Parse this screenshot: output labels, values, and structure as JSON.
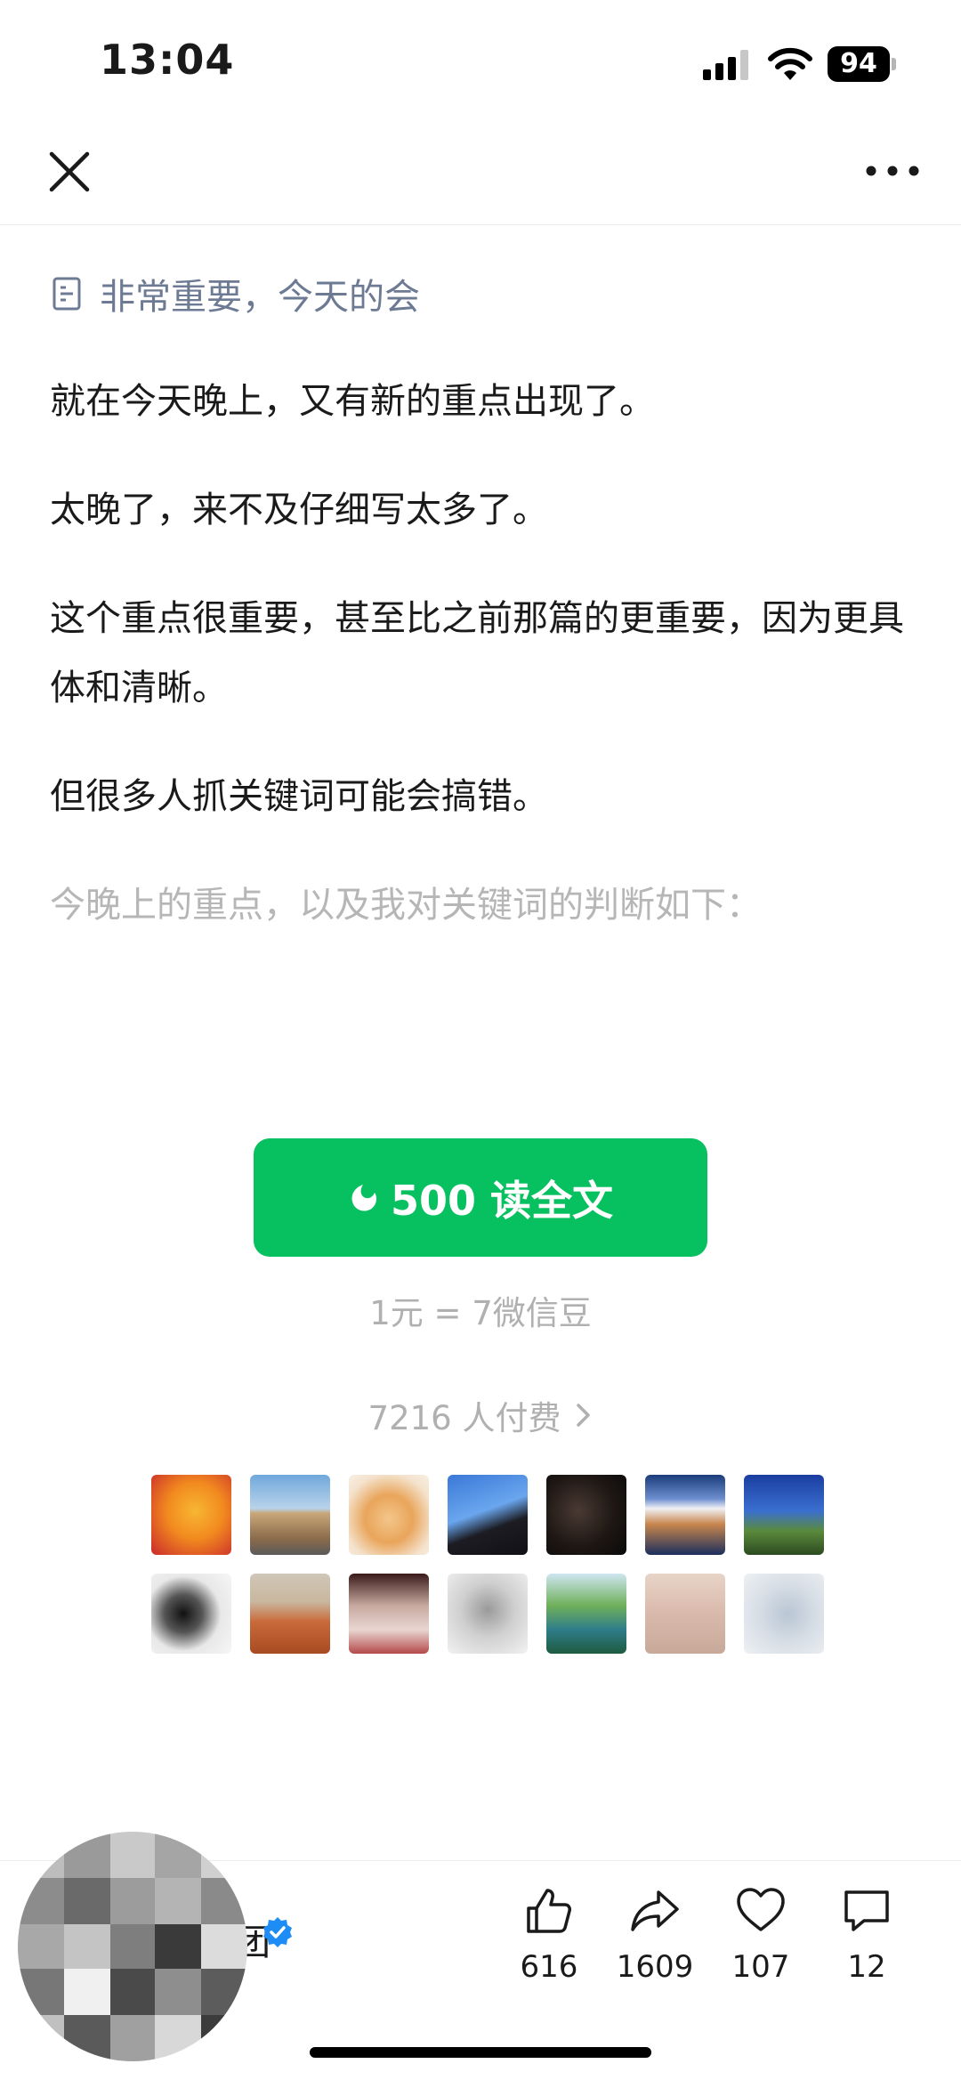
{
  "status_bar": {
    "time": "13:04",
    "battery": "94"
  },
  "nav": {
    "close_icon": "close-icon",
    "more_icon": "more-icon"
  },
  "article": {
    "title": "非常重要，今天的会",
    "paragraphs": [
      "就在今天晚上，又有新的重点出现了。",
      "太晚了，来不及仔细写太多了。",
      "这个重点很重要，甚至比之前那篇的更重要，因为更具体和清晰。",
      "但很多人抓关键词可能会搞错。"
    ],
    "preview_line": "今晚上的重点，以及我对关键词的判断如下："
  },
  "paywall": {
    "button_label": "500 读全文",
    "rate": "1元 = 7微信豆",
    "payers": "7216 人付费",
    "accent_color": "#07c160"
  },
  "author": {
    "name_fragment": "团"
  },
  "actions": {
    "like_count": "616",
    "share_count": "1609",
    "favorite_count": "107",
    "comment_count": "12"
  }
}
